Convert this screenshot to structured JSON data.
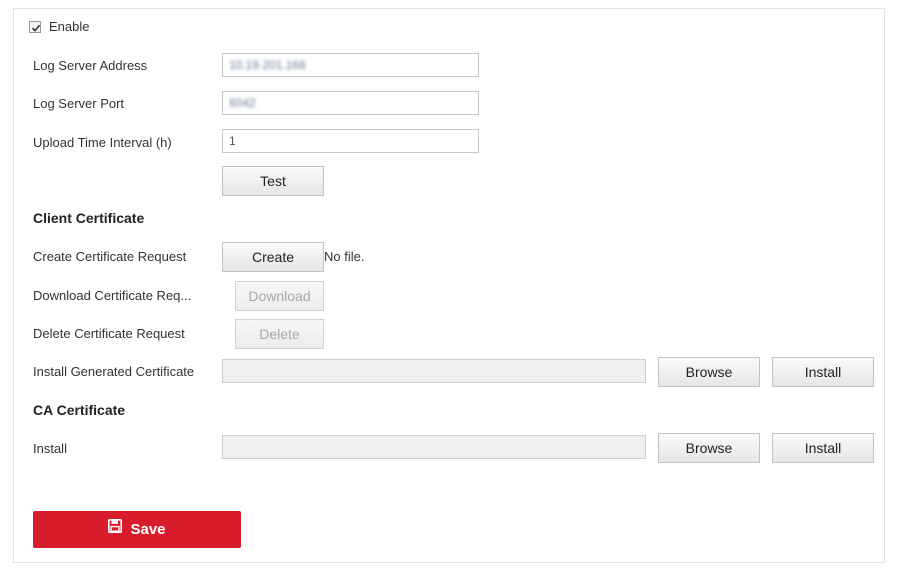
{
  "enable": {
    "label": "Enable",
    "checked": true
  },
  "log_server_address": {
    "label": "Log Server Address",
    "value": "10.19.201.168"
  },
  "log_server_port": {
    "label": "Log Server Port",
    "value": "6042"
  },
  "upload_interval": {
    "label": "Upload Time Interval (h)",
    "value": "1"
  },
  "test_button": "Test",
  "client_certificate": {
    "title": "Client Certificate",
    "create_label": "Create Certificate Request",
    "create_button": "Create",
    "file_status": "No file.",
    "download_label": "Download Certificate Req...",
    "download_button": "Download",
    "delete_label": "Delete Certificate Request",
    "delete_button": "Delete",
    "install_label": "Install Generated Certificate",
    "browse_button": "Browse",
    "install_button": "Install"
  },
  "ca_certificate": {
    "title": "CA Certificate",
    "install_label": "Install",
    "browse_button": "Browse",
    "install_button": "Install"
  },
  "save_button": "Save",
  "colors": {
    "save_bg": "#d71d2b",
    "border": "#c8c8c8",
    "disabled_text": "#a8a8a8"
  },
  "icons": {
    "enable_check": "checkmark-icon",
    "save": "floppy-disk-icon"
  }
}
